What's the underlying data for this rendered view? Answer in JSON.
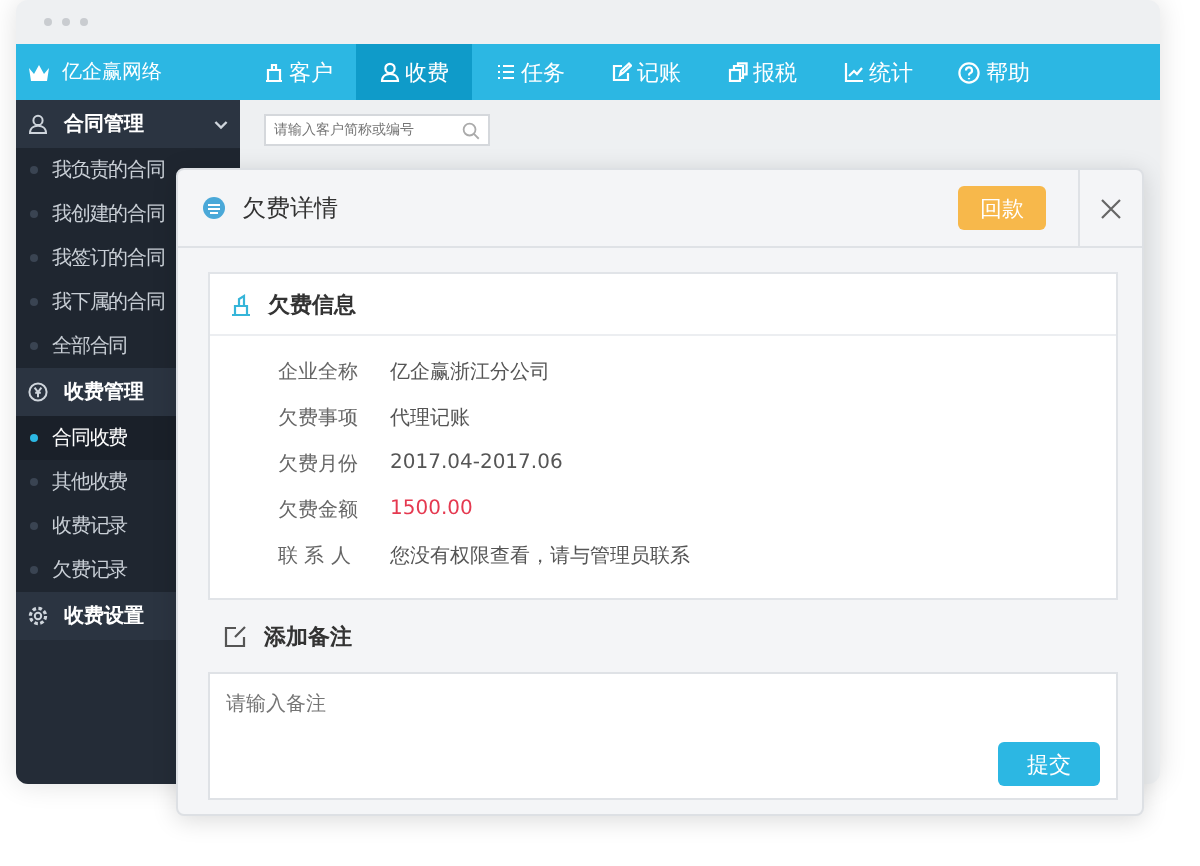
{
  "brand": "亿企赢网络",
  "nav_tabs": [
    {
      "label": "客户",
      "selected": false
    },
    {
      "label": "收费",
      "selected": true
    },
    {
      "label": "任务",
      "selected": false
    },
    {
      "label": "记账",
      "selected": false
    },
    {
      "label": "报税",
      "selected": false
    },
    {
      "label": "统计",
      "selected": false
    },
    {
      "label": "帮助",
      "selected": false
    }
  ],
  "sidebar": {
    "groups": [
      {
        "label": "合同管理",
        "children": [
          {
            "label": "我负责的合同",
            "selected": false
          },
          {
            "label": "我创建的合同",
            "selected": false
          },
          {
            "label": "我签订的合同",
            "selected": false
          },
          {
            "label": "我下属的合同",
            "selected": false
          },
          {
            "label": "全部合同",
            "selected": false
          }
        ]
      },
      {
        "label": "收费管理",
        "children": [
          {
            "label": "合同收费",
            "selected": true
          },
          {
            "label": "其他收费",
            "selected": false
          },
          {
            "label": "收费记录",
            "selected": false
          },
          {
            "label": "欠费记录",
            "selected": false
          }
        ]
      },
      {
        "label": "收费设置"
      }
    ]
  },
  "search": {
    "placeholder": "请输入客户简称或编号"
  },
  "dialog": {
    "title": "欠费详情",
    "action_button": "回款",
    "card_title": "欠费信息",
    "fields": [
      {
        "label": "企业全称",
        "value": "亿企赢浙江分公司",
        "kind": "plain"
      },
      {
        "label": "欠费事项",
        "value": "代理记账",
        "kind": "plain"
      },
      {
        "label": "欠费月份",
        "value": "2017.04-2017.06",
        "kind": "plain"
      },
      {
        "label": "欠费金额",
        "value": "1500.00",
        "kind": "amount"
      },
      {
        "label": "联 系 人",
        "value": "您没有权限查看，请与管理员联系",
        "kind": "plain"
      }
    ],
    "note_title": "添加备注",
    "note_placeholder": "请输入备注",
    "submit_button": "提交"
  }
}
